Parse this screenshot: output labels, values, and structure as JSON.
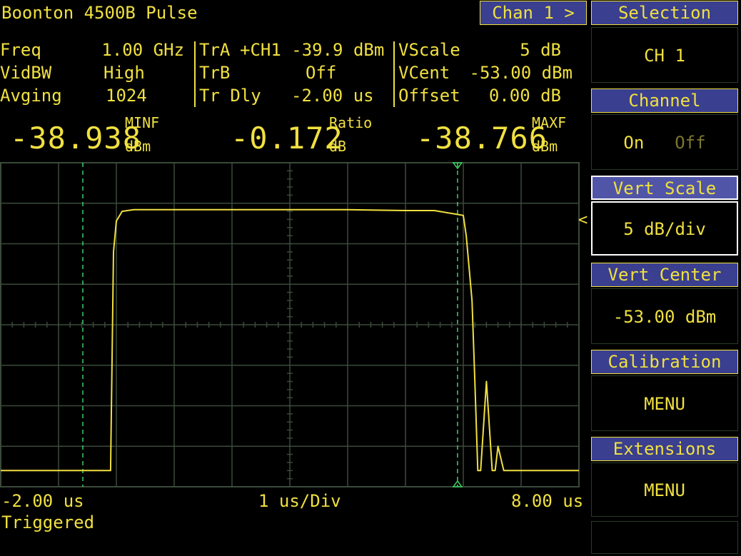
{
  "header": {
    "title": "Boonton 4500B Pulse",
    "chan_button": "Chan 1 >"
  },
  "params": {
    "col1": [
      {
        "label": "Freq",
        "value": "1.00 GHz"
      },
      {
        "label": "VidBW",
        "value": "High"
      },
      {
        "label": "Avging",
        "value": "1024"
      }
    ],
    "col2": [
      {
        "label": "TrA",
        "value": "+CH1 -39.9 dBm"
      },
      {
        "label": "TrB",
        "value": "Off"
      },
      {
        "label": "Tr Dly",
        "value": "-2.00 us"
      }
    ],
    "col3": [
      {
        "label": "VScale",
        "value": "5 dB"
      },
      {
        "label": "VCent",
        "value": "-53.00 dBm"
      },
      {
        "label": "Offset",
        "value": "0.00 dB"
      }
    ]
  },
  "readouts": {
    "left": {
      "value": "-38.938",
      "label": "MINF",
      "unit": "dBm"
    },
    "middle": {
      "value": "-0.172",
      "label": "Ratio",
      "unit": "dB"
    },
    "right": {
      "value": "-38.766",
      "label": "MAXF",
      "unit": "dBm"
    }
  },
  "footer": {
    "x_start": "-2.00 us",
    "timebase": "1 us/Div",
    "x_end": "8.00 us",
    "status": "Triggered"
  },
  "menu": {
    "selection": {
      "title": "Selection",
      "value": "CH 1"
    },
    "channel": {
      "title": "Channel",
      "on": "On",
      "off": "Off"
    },
    "vert_scale": {
      "title": "Vert Scale",
      "value": "5 dB/div"
    },
    "vert_center": {
      "title": "Vert Center",
      "value": "-53.00 dBm"
    },
    "calibration": {
      "title": "Calibration",
      "value": "MENU"
    },
    "extensions": {
      "title": "Extensions",
      "value": "MENU"
    },
    "reference_marker": "<"
  },
  "colors": {
    "trace": "#f0e040",
    "grid": "#3a4a3a",
    "marker": "#40d060",
    "button_bg": "#3a3f8f"
  },
  "chart_data": {
    "type": "line",
    "x_range": [
      -2.0,
      8.0
    ],
    "x_unit": "us",
    "y_range": [
      -73.0,
      -33.0
    ],
    "y_unit": "dBm",
    "x_divisions": 10,
    "y_divisions": 8,
    "grid": true,
    "markers_x": [
      -0.58,
      5.9
    ],
    "series": [
      {
        "x": [
          -2.0,
          -0.1,
          -0.05,
          0.0,
          0.1,
          0.3,
          1.0,
          2.0,
          3.0,
          4.0,
          5.0,
          5.5,
          6.0,
          6.05,
          6.15,
          6.2,
          6.25,
          6.3,
          6.4,
          6.5,
          6.55,
          6.6,
          6.7,
          6.8,
          8.0
        ],
        "y": [
          -71.0,
          -71.0,
          -44.0,
          -40.2,
          -39.0,
          -38.8,
          -38.8,
          -38.8,
          -38.8,
          -38.8,
          -38.9,
          -38.9,
          -39.5,
          -42.0,
          -50.0,
          -60.0,
          -71.0,
          -71.0,
          -60.0,
          -71.0,
          -71.0,
          -68.0,
          -71.0,
          -71.0,
          -71.0
        ]
      }
    ]
  }
}
